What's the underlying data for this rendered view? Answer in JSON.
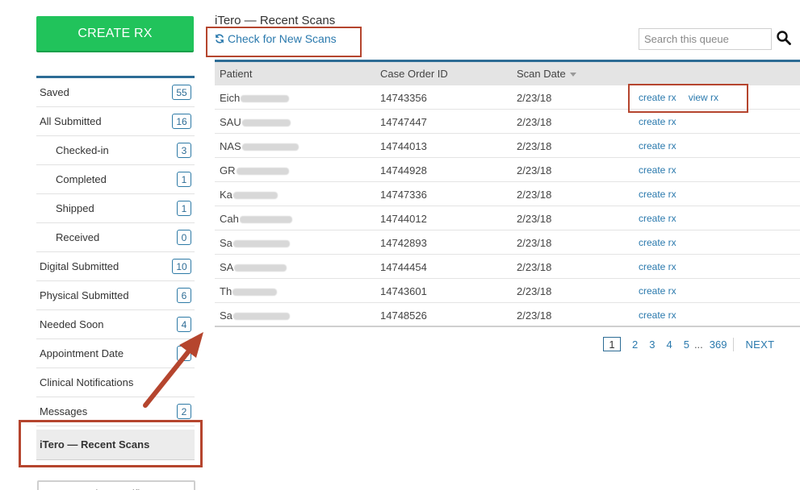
{
  "sidebar": {
    "create_rx_label": "CREATE RX",
    "items": [
      {
        "label": "Saved",
        "badge": "55"
      },
      {
        "label": "All Submitted",
        "badge": "16"
      },
      {
        "label": "Checked-in",
        "badge": "3"
      },
      {
        "label": "Completed",
        "badge": "1"
      },
      {
        "label": "Shipped",
        "badge": "1"
      },
      {
        "label": "Received",
        "badge": "0"
      },
      {
        "label": "Digital Submitted",
        "badge": "10"
      },
      {
        "label": "Physical Submitted",
        "badge": "6"
      },
      {
        "label": "Needed Soon",
        "badge": "4"
      },
      {
        "label": "Appointment Date",
        "badge": ""
      },
      {
        "label": "Clinical Notifications",
        "badge": ""
      },
      {
        "label": "Messages",
        "badge": "2"
      },
      {
        "label": "iTero — Recent Scans",
        "badge": ""
      }
    ],
    "bottom_button_label": "Together, Notificat..."
  },
  "main": {
    "title": "iTero — Recent Scans",
    "check_scans_label": "Check for New Scans",
    "search": {
      "placeholder": "Search this queue",
      "value": ""
    },
    "table": {
      "columns": [
        "Patient",
        "Case Order ID",
        "Scan Date"
      ],
      "rows": [
        {
          "patient": "Eich",
          "order_id": "14743356",
          "scan_date": "2/23/18",
          "actions": [
            "create rx",
            "view rx"
          ]
        },
        {
          "patient": "SAU",
          "order_id": "14747447",
          "scan_date": "2/23/18",
          "actions": [
            "create rx"
          ]
        },
        {
          "patient": "NAS",
          "order_id": "14744013",
          "scan_date": "2/23/18",
          "actions": [
            "create rx"
          ]
        },
        {
          "patient": "GR",
          "order_id": "14744928",
          "scan_date": "2/23/18",
          "actions": [
            "create rx"
          ]
        },
        {
          "patient": "Ka",
          "order_id": "14747336",
          "scan_date": "2/23/18",
          "actions": [
            "create rx"
          ]
        },
        {
          "patient": "Cah",
          "order_id": "14744012",
          "scan_date": "2/23/18",
          "actions": [
            "create rx"
          ]
        },
        {
          "patient": "Sa",
          "order_id": "14742893",
          "scan_date": "2/23/18",
          "actions": [
            "create rx"
          ]
        },
        {
          "patient": "SA",
          "order_id": "14744454",
          "scan_date": "2/23/18",
          "actions": [
            "create rx"
          ]
        },
        {
          "patient": "Th",
          "order_id": "14743601",
          "scan_date": "2/23/18",
          "actions": [
            "create rx"
          ]
        },
        {
          "patient": "Sa",
          "order_id": "14748526",
          "scan_date": "2/23/18",
          "actions": [
            "create rx"
          ]
        }
      ]
    },
    "pagination": {
      "pages": [
        "1",
        "2",
        "3",
        "4",
        "5"
      ],
      "ellipsis": "...",
      "last_page": "369",
      "next_label": "NEXT"
    }
  },
  "colors": {
    "accent_green": "#21c35b",
    "link_blue": "#2a79ad",
    "annotation_red": "#b5452e",
    "nav_border": "#2d6c95"
  }
}
